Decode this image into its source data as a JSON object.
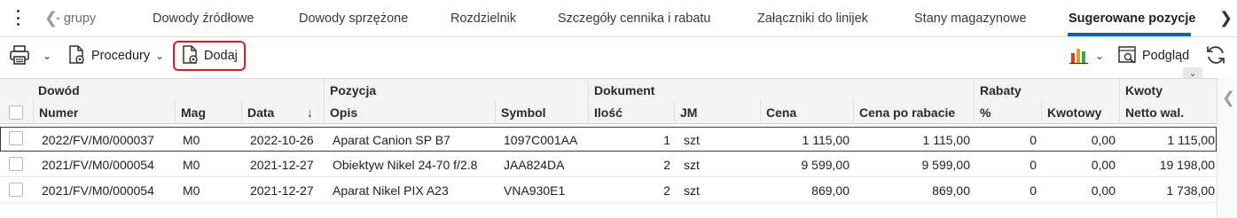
{
  "tabs": [
    {
      "label": "- grupy",
      "active": false
    },
    {
      "label": "Dowody źródłowe",
      "active": false
    },
    {
      "label": "Dowody sprzężone",
      "active": false
    },
    {
      "label": "Rozdzielnik",
      "active": false
    },
    {
      "label": "Szczegóły cennika i rabatu",
      "active": false
    },
    {
      "label": "Załączniki do linijek",
      "active": false
    },
    {
      "label": "Stany magazynowe",
      "active": false
    },
    {
      "label": "Sugerowane pozycje",
      "active": true
    }
  ],
  "toolbar": {
    "procedury_label": "Procedury",
    "dodaj_label": "Dodaj",
    "podglad_label": "Podgląd"
  },
  "grid": {
    "groups": [
      "Dowód",
      "Pozycja",
      "Dokument",
      "Rabaty",
      "Kwoty"
    ],
    "columns": [
      "Numer",
      "Mag",
      "Data",
      "Opis",
      "Symbol",
      "Ilość",
      "JM",
      "Cena",
      "Cena po rabacie",
      "%",
      "Kwotowy",
      "Netto wal."
    ],
    "sort_column": "Data",
    "rows": [
      {
        "numer": "2022/FV/M0/000037",
        "mag": "M0",
        "data": "2022-10-26",
        "opis": "Aparat Canion SP B7",
        "symbol": "1097C001AA",
        "ilosc": "1",
        "jm": "szt",
        "cena": "1 115,00",
        "cena_po_rabacie": "1 115,00",
        "procent": "0",
        "kwotowy": "0,00",
        "netto": "1 115,00"
      },
      {
        "numer": "2021/FV/M0/000054",
        "mag": "M0",
        "data": "2021-12-27",
        "opis": "Obiektyw Nikel 24-70 f/2.8",
        "symbol": "JAA824DA",
        "ilosc": "2",
        "jm": "szt",
        "cena": "9 599,00",
        "cena_po_rabacie": "9 599,00",
        "procent": "0",
        "kwotowy": "0,00",
        "netto": "19 198,00"
      },
      {
        "numer": "2021/FV/M0/000054",
        "mag": "M0",
        "data": "2021-12-27",
        "opis": "Aparat Nikel PIX A23",
        "symbol": "VNA930E1",
        "ilosc": "2",
        "jm": "szt",
        "cena": "869,00",
        "cena_po_rabacie": "869,00",
        "procent": "0",
        "kwotowy": "0,00",
        "netto": "1 738,00"
      }
    ]
  },
  "icons": {
    "menu": "kebab-menu-icon",
    "print": "printer-icon",
    "procedures": "document-gear-icon",
    "add": "document-gear-icon",
    "chart": "bar-chart-icon",
    "preview": "preview-icon",
    "refresh": "refresh-icon"
  },
  "colors": {
    "accent": "#0a67a8",
    "highlight": "#e0191e"
  }
}
